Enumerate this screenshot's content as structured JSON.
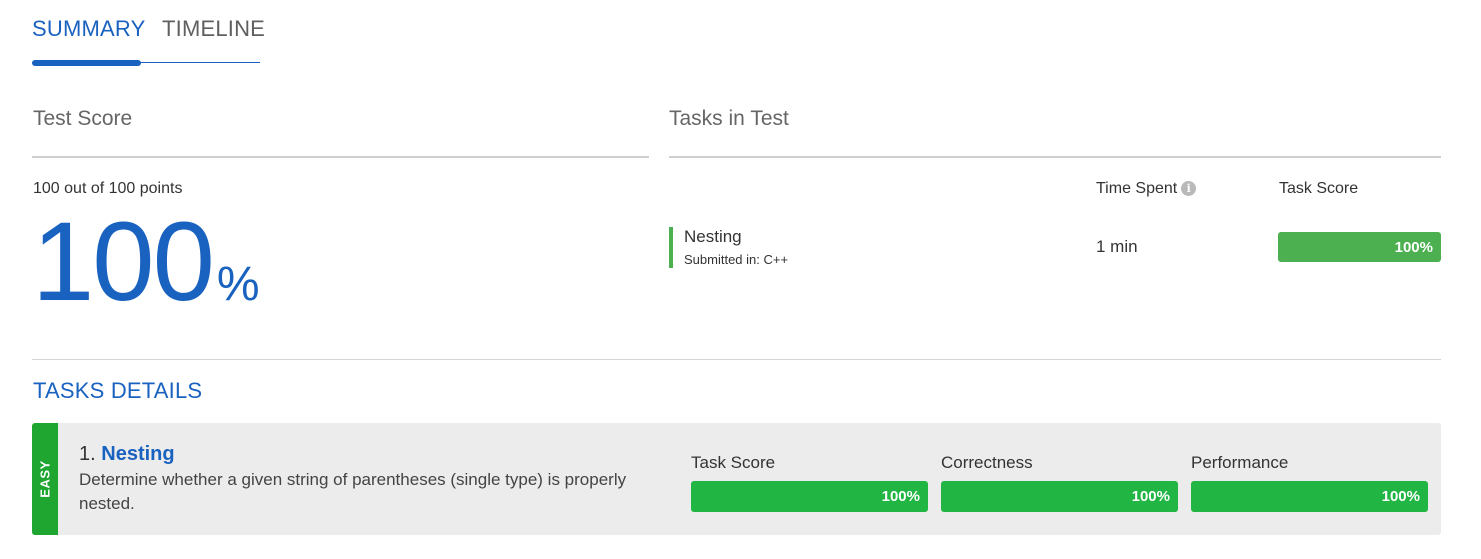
{
  "tabs": [
    {
      "label": "SUMMARY",
      "active": true
    },
    {
      "label": "TIMELINE",
      "active": false
    }
  ],
  "test_score": {
    "title": "Test Score",
    "points_text": "100 out of 100 points",
    "percent_value": "100",
    "percent_sign": "%"
  },
  "tasks_in_test": {
    "title": "Tasks in Test",
    "columns": {
      "time_spent": "Time Spent",
      "task_score": "Task Score"
    },
    "info_icon": "info-icon",
    "rows": [
      {
        "name": "Nesting",
        "submitted": "Submitted in: C++",
        "time": "1 min",
        "score_label": "100%",
        "score_fraction": 1.0
      }
    ]
  },
  "tasks_details": {
    "title": "TASKS DETAILS",
    "tasks": [
      {
        "difficulty": "EASY",
        "number": "1.",
        "name": "Nesting",
        "description": "Determine whether a given string of parentheses (single type) is properly nested.",
        "metrics": [
          {
            "label": "Task Score",
            "value": "100%",
            "fraction": 1.0
          },
          {
            "label": "Correctness",
            "value": "100%",
            "fraction": 1.0
          },
          {
            "label": "Performance",
            "value": "100%",
            "fraction": 1.0
          }
        ]
      }
    ]
  },
  "colors": {
    "accent": "#1a62c0",
    "row_bar": "#4caf50",
    "score_bar_top": "#4caf50",
    "metric_bar": "#21b543",
    "easy_strip": "#1ea631"
  }
}
